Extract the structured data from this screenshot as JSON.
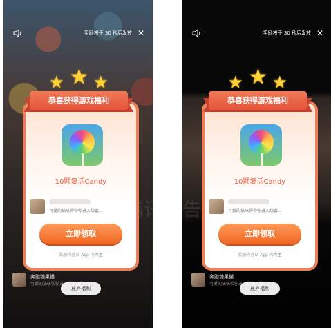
{
  "panels": [
    {
      "reward_timer": "奖励将于 30 秒后发放",
      "close_icon": "close-icon",
      "sound_icon": "speaker-icon",
      "ribbon_title": "恭喜获得游戏福利",
      "game_name": "10颗复活Candy",
      "ad_desc": "可爱的猫咪得带你进入甜蜜...",
      "claim_label": "立即领取",
      "provider_note": "奖励内容以 App 内为主",
      "giveup_label": "放弃福利",
      "bottom_ad_title": "奔跑糖果猫",
      "bottom_ad_desc": "可爱的猫咪带你进入甜蜜冒险"
    },
    {
      "reward_timer": "奖励将于 30 秒后发放",
      "close_icon": "close-icon",
      "sound_icon": "speaker-icon",
      "ribbon_title": "恭喜获得游戏福利",
      "game_name": "10颗复活Candy",
      "ad_desc": "可爱的猫咪得带你进入甜蜜...",
      "claim_label": "立即领取",
      "provider_note": "奖励内容以 App 内为主",
      "giveup_label": "放弃福利",
      "bottom_ad_title": "奔跑糖果猫",
      "bottom_ad_desc": "可爱的猫咪带你进入甜蜜冒险"
    }
  ],
  "watermark": "腾讯广告",
  "colors": {
    "accent": "#f06522",
    "ribbon": "#e4533a",
    "card_border": "#ec7f57",
    "star": "#ffd23a"
  }
}
